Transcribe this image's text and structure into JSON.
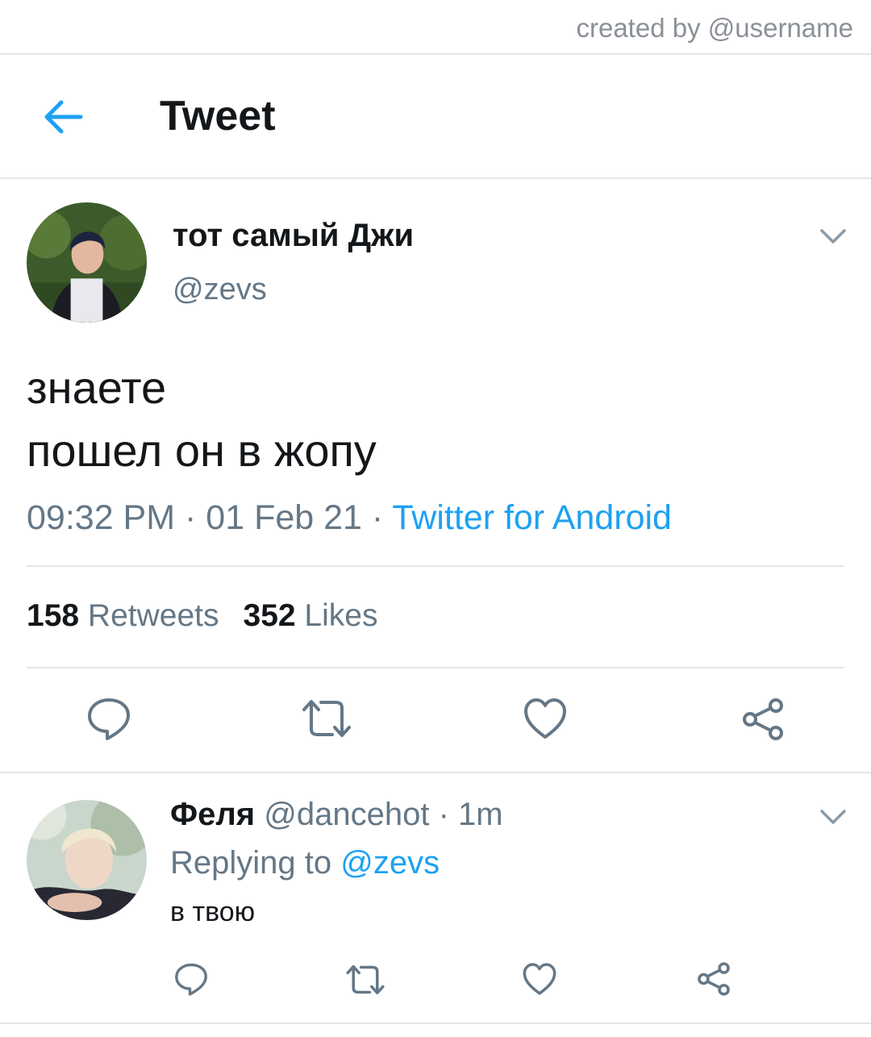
{
  "watermark": {
    "text": "created by @username"
  },
  "header": {
    "title": "Tweet",
    "back_icon": "back-arrow-icon",
    "accent": "#1da1f2"
  },
  "tweet": {
    "author_name": "тот самый Джи",
    "author_handle": "@zevs",
    "text_lines": [
      "знаете",
      "пошел он в жопу"
    ],
    "time": "09:32 PM",
    "date": "01 Feb 21",
    "source": "Twitter for Android",
    "retweets_count": "158",
    "retweets_label": "Retweets",
    "likes_count": "352",
    "likes_label": "Likes",
    "actions": [
      "reply-icon",
      "retweet-icon",
      "like-icon",
      "share-icon"
    ]
  },
  "reply": {
    "author_name": "Феля",
    "author_handle": "@dancehot",
    "time": "1m",
    "replying_to_label": "Replying to",
    "replying_to_handle": "@zevs",
    "text": "в твою",
    "actions": [
      "reply-icon",
      "retweet-icon",
      "like-icon",
      "share-icon"
    ]
  },
  "colors": {
    "text": "#14171a",
    "secondary": "#657786",
    "link": "#1da1f2",
    "icon": "#657786",
    "divider": "#e3e6e8"
  }
}
